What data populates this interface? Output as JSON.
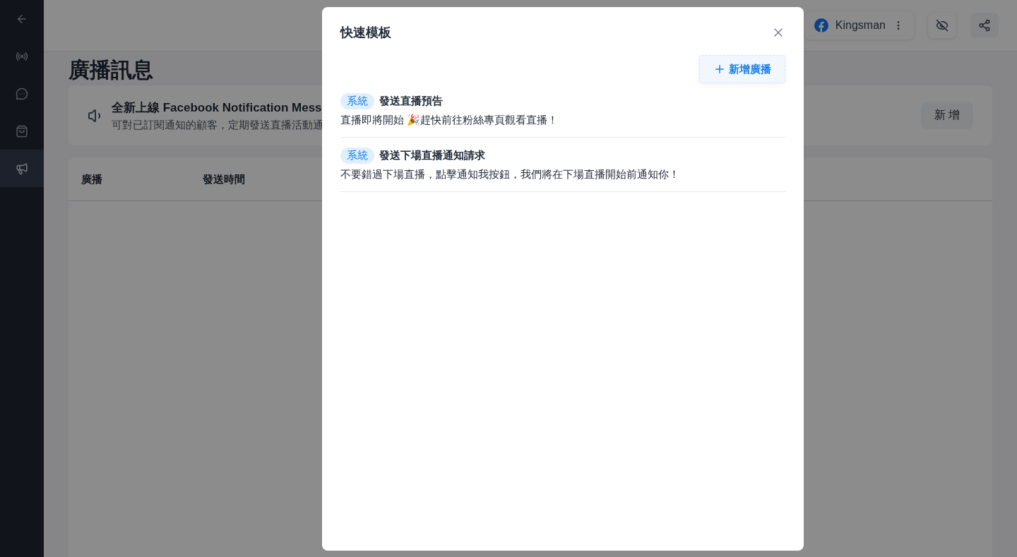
{
  "sidebar": {
    "items": [
      {
        "selected": false
      },
      {
        "selected": false
      },
      {
        "selected": false
      },
      {
        "selected": false
      },
      {
        "selected": true
      }
    ]
  },
  "header": {
    "page": {
      "name": "Kingsman"
    }
  },
  "page_title": "廣播訊息",
  "banner": {
    "title": "全新上線 Facebook Notification Mess",
    "description": "可對已訂閱通知的顧客，定期發送直播活動通",
    "button": "新 增"
  },
  "table": {
    "columns": [
      "廣播",
      "發送時間"
    ]
  },
  "modal": {
    "title": "快速模板",
    "add_button": "新增廣播",
    "templates": [
      {
        "tag": "系統",
        "title": "發送直播預告",
        "body": "直播即將開始 🎉趕快前往粉絲專頁觀看直播！"
      },
      {
        "tag": "系統",
        "title": "發送下場直播通知請求",
        "body": "不要錯過下場直播，點擊通知我按鈕，我們將在下場直播開始前通知你！"
      }
    ]
  }
}
